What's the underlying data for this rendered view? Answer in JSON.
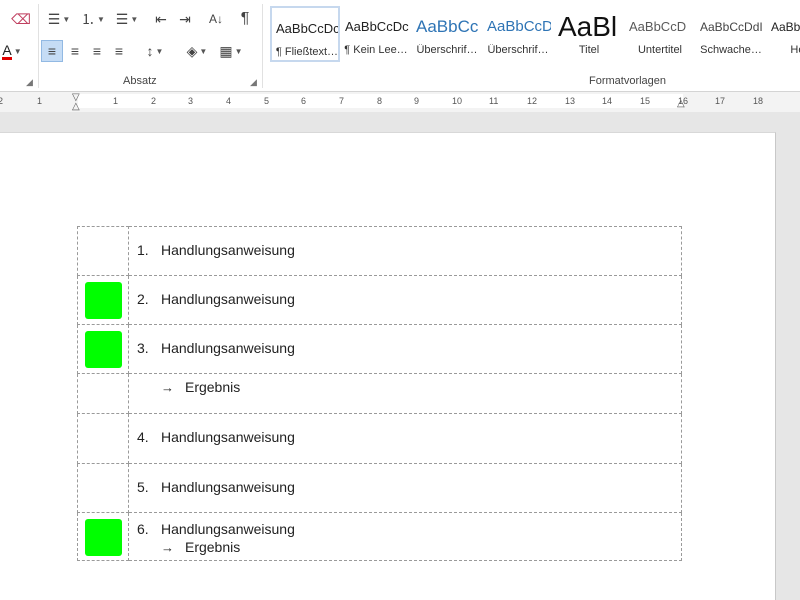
{
  "ribbon": {
    "groups": {
      "paragraph": "Absatz",
      "styles": "Formatvorlagen"
    },
    "buttons": {
      "clear": "⌫",
      "font_color": "A",
      "bullets": "☰",
      "numbering": "⒈",
      "multilevel": "☰",
      "outdent": "⇤",
      "indent": "⇥",
      "sort": "A↓",
      "pilcrow": "¶",
      "shading": "◈",
      "borders": "▦",
      "line_spacing": "↕"
    },
    "styles": [
      {
        "sample": "AaBbCcDc",
        "name": "¶ Fließtext…",
        "color": "#222222",
        "size": "13px"
      },
      {
        "sample": "AaBbCcDc",
        "name": "¶ Kein Lee…",
        "color": "#222222",
        "size": "13px"
      },
      {
        "sample": "AaBbCc",
        "name": "Überschrif…",
        "color": "#2e74b5",
        "size": "17px"
      },
      {
        "sample": "AaBbCcD",
        "name": "Überschrif…",
        "color": "#2e74b5",
        "size": "15px"
      },
      {
        "sample": "AaBl",
        "name": "Titel",
        "color": "#111111",
        "size": "28px"
      },
      {
        "sample": "AaBbCcD",
        "name": "Untertitel",
        "color": "#5a5a5a",
        "size": "13px"
      },
      {
        "sample": "AaBbCcDdI",
        "name": "Schwache…",
        "color": "#444444",
        "size": "12px"
      },
      {
        "sample": "AaBb",
        "name": "Herv",
        "color": "#222222",
        "size": "12px"
      }
    ]
  },
  "ruler": {
    "labels": [
      "2",
      "1",
      "1",
      "2",
      "3",
      "4",
      "5",
      "6",
      "7",
      "8",
      "9",
      "10",
      "11",
      "12",
      "13",
      "14",
      "15",
      "16",
      "17",
      "18"
    ]
  },
  "table": {
    "rows": [
      {
        "green": false,
        "lines": [
          {
            "kind": "num",
            "marker": "1.",
            "text": "Handlungsanweisung"
          }
        ]
      },
      {
        "green": true,
        "lines": [
          {
            "kind": "num",
            "marker": "2.",
            "text": "Handlungsanweisung"
          }
        ]
      },
      {
        "green": true,
        "lines": [
          {
            "kind": "num",
            "marker": "3.",
            "text": "Handlungsanweisung"
          }
        ]
      },
      {
        "green": false,
        "lines": [
          {
            "kind": "arrow",
            "marker": "→",
            "text": "Ergebnis"
          }
        ]
      },
      {
        "green": false,
        "lines": [
          {
            "kind": "num",
            "marker": "4.",
            "text": "Handlungsanweisung"
          }
        ]
      },
      {
        "green": false,
        "lines": [
          {
            "kind": "num",
            "marker": "5.",
            "text": "Handlungsanweisung"
          }
        ]
      },
      {
        "green": true,
        "lines": [
          {
            "kind": "num",
            "marker": "6.",
            "text": "Handlungsanweisung"
          },
          {
            "kind": "arrow",
            "marker": "→",
            "text": "Ergebnis"
          }
        ]
      }
    ]
  },
  "colors": {
    "icon_green": "#00ff00",
    "selected": "#c5dcf5"
  }
}
